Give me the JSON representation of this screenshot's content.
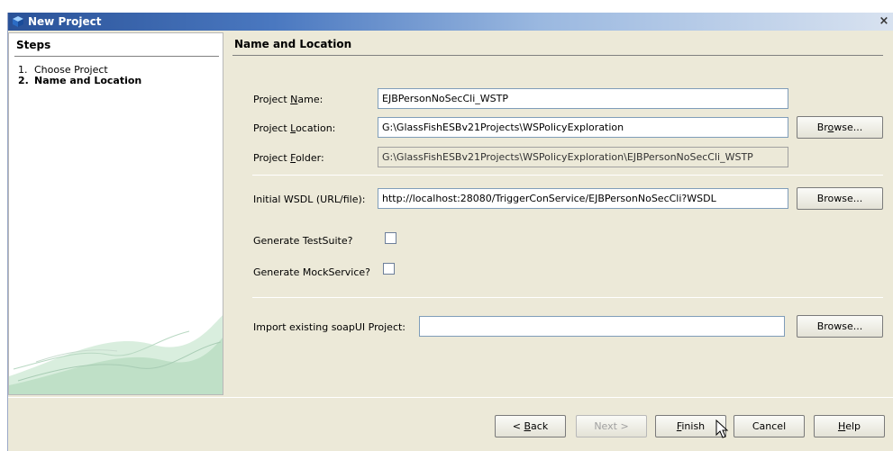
{
  "window": {
    "title": "New Project",
    "close_label": "×"
  },
  "steps": {
    "title": "Steps",
    "items": [
      {
        "num": "1.",
        "label": "Choose Project"
      },
      {
        "num": "2.",
        "label": "Name and Location"
      }
    ]
  },
  "section": {
    "title": "Name and Location"
  },
  "form": {
    "project_name": {
      "pre": "Project ",
      "mn": "N",
      "post": "ame:",
      "value": "EJBPersonNoSecCli_WSTP"
    },
    "project_location": {
      "pre": "Project ",
      "mn": "L",
      "post": "ocation:",
      "value": "G:\\GlassFishESBv21Projects\\WSPolicyExploration"
    },
    "project_folder": {
      "pre": "Project ",
      "mn": "F",
      "post": "older:",
      "value": "G:\\GlassFishESBv21Projects\\WSPolicyExploration\\EJBPersonNoSecCli_WSTP"
    },
    "initial_wsdl": {
      "label": "Initial WSDL (URL/file):",
      "value": "http://localhost:28080/TriggerConService/EJBPersonNoSecCli?WSDL"
    },
    "generate_testsuite": {
      "label": "Generate TestSuite?",
      "checked": false
    },
    "generate_mockservice": {
      "label": "Generate MockService?",
      "checked": false
    },
    "import_soapui": {
      "label": "Import existing soapUI Project:",
      "value": ""
    }
  },
  "browse_buttons": {
    "location": {
      "pre": "Br",
      "mn": "o",
      "post": "wse..."
    },
    "wsdl": {
      "label": "Browse..."
    },
    "soapui": {
      "label": "Browse..."
    }
  },
  "footer": {
    "back": {
      "pre": "< ",
      "mn": "B",
      "post": "ack"
    },
    "next": {
      "label": "Next >",
      "enabled": false
    },
    "finish": {
      "pre": "",
      "mn": "F",
      "post": "inish"
    },
    "cancel": {
      "label": "Cancel"
    },
    "help": {
      "pre": "",
      "mn": "H",
      "post": "elp"
    }
  },
  "icons": {
    "title_icon": "netbeans-cube-icon",
    "close": "close-icon",
    "cursor": "mouse-pointer-icon"
  }
}
